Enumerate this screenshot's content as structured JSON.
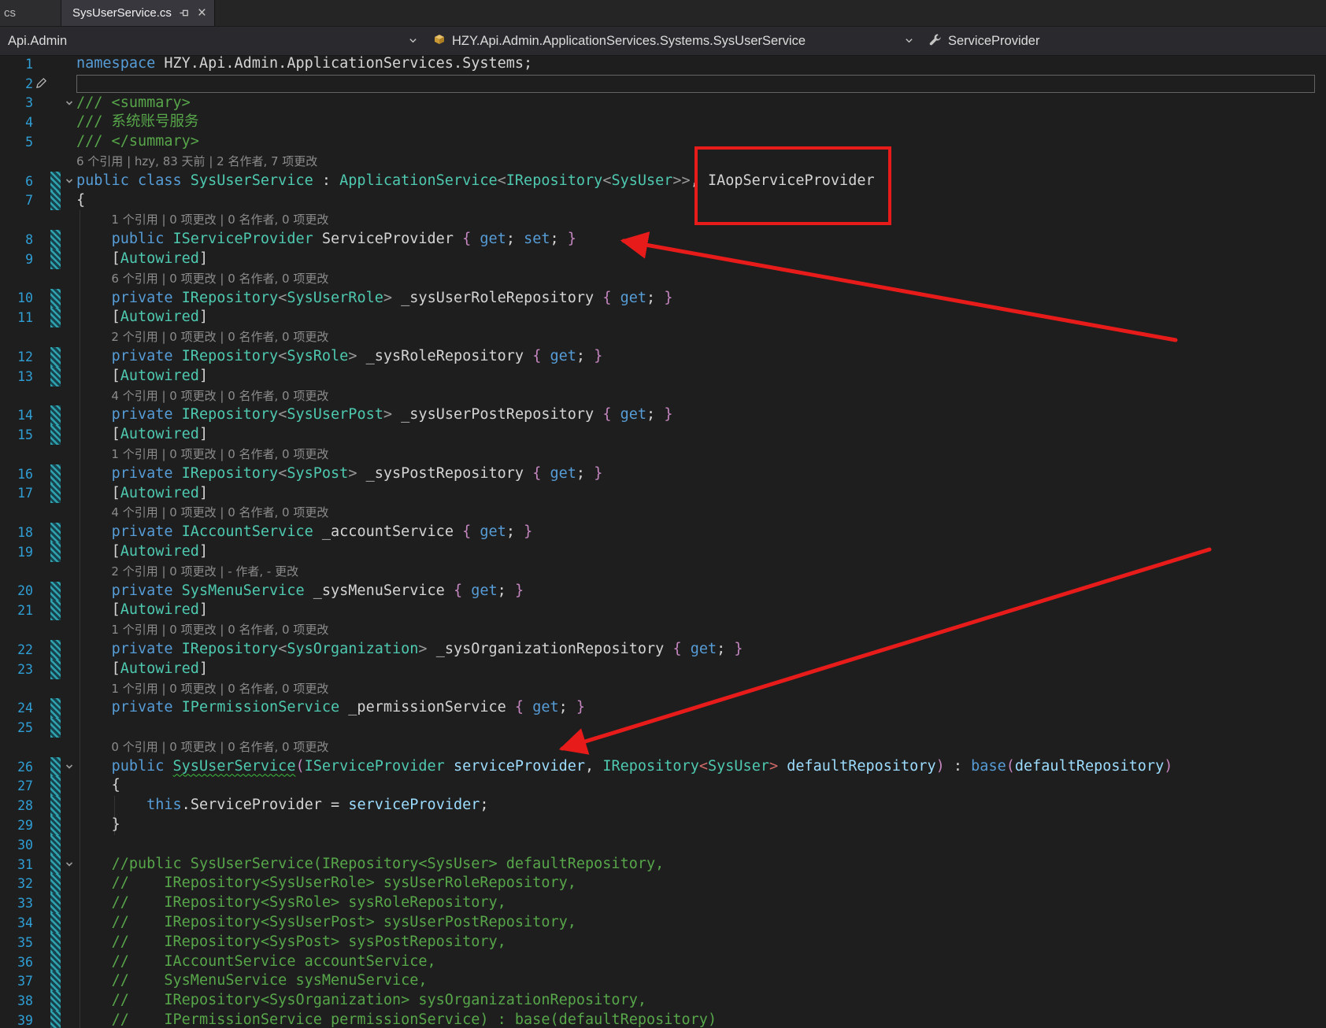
{
  "tabs": {
    "partial_label": "cs",
    "active_label": "SysUserService.cs"
  },
  "navbar": {
    "project": "Api.Admin",
    "type": "HZY.Api.Admin.ApplicationServices.Systems.SysUserService",
    "member": "ServiceProvider"
  },
  "icons": {
    "tab_pin": "pin-icon",
    "tab_close_glyph": "×",
    "type_glyph": "class-icon",
    "member_glyph": "wrench-icon",
    "fold_glyph": "chevron-down-icon",
    "gutter_edit": "pencil-icon",
    "dropdown_glyph": "chevron-down-icon"
  },
  "annotations": {
    "color": "#e81b1b",
    "boxed_text": "IAopServiceProvider",
    "arrows": 2
  },
  "colors": {
    "background": "#1e1e1e",
    "keyword": "#569cd6",
    "type": "#4ec9b0",
    "comment": "#57a64a",
    "parameter": "#9cdcfe",
    "brace": "#c586c0",
    "line_number": "#2f9fd6",
    "change_stripe": "#2fa3ad"
  },
  "editor": {
    "rows": [
      {
        "n": "1",
        "x": [
          [
            "namespace ",
            "kw"
          ],
          [
            "HZY.Api.Admin.ApplicationServices.Systems",
            "pl"
          ],
          [
            ";",
            "pl"
          ]
        ]
      },
      {
        "n": "2",
        "cur": true,
        "pencil": true,
        "x": []
      },
      {
        "n": "3",
        "fold": true,
        "x": [
          [
            "/// <summary>",
            "cm"
          ]
        ]
      },
      {
        "n": "4",
        "x": [
          [
            "/// 系统账号服务",
            "cm"
          ]
        ]
      },
      {
        "n": "5",
        "x": [
          [
            "/// </summary>",
            "cm"
          ]
        ]
      },
      {
        "t": "lens",
        "indent": 0,
        "text": "6 个引用 | hzy, 83 天前 | 2 名作者, 7 项更改"
      },
      {
        "n": "6",
        "fold": true,
        "stripe": true,
        "x": [
          [
            "public ",
            "kw"
          ],
          [
            "class ",
            "kw"
          ],
          [
            "SysUserService",
            "ty"
          ],
          [
            " : ",
            "pl"
          ],
          [
            "ApplicationService",
            "ty"
          ],
          [
            "<",
            "ang"
          ],
          [
            "IRepository",
            "ty"
          ],
          [
            "<",
            "ang"
          ],
          [
            "SysUser",
            "ty"
          ],
          [
            ">>",
            "ang"
          ],
          [
            ", ",
            "pl"
          ],
          [
            "IAopServiceProvider",
            "pl"
          ]
        ]
      },
      {
        "n": "7",
        "stripe": true,
        "x": [
          [
            "{",
            "pl"
          ]
        ]
      },
      {
        "t": "lens",
        "indent": 4,
        "text": "1 个引用 | 0 项更改 | 0 名作者, 0 项更改"
      },
      {
        "n": "8",
        "stripe": true,
        "x": [
          [
            "    ",
            "pl"
          ],
          [
            "public ",
            "kw"
          ],
          [
            "IServiceProvider",
            "ty"
          ],
          [
            " ServiceProvider ",
            "pl"
          ],
          [
            "{",
            "br"
          ],
          [
            " ",
            "pl"
          ],
          [
            "get",
            "kw"
          ],
          [
            "; ",
            "pl"
          ],
          [
            "set",
            "kw"
          ],
          [
            "; ",
            "pl"
          ],
          [
            "}",
            "br"
          ]
        ]
      },
      {
        "n": "9",
        "stripe": true,
        "x": [
          [
            "    ",
            "pl"
          ],
          [
            "[",
            "pl"
          ],
          [
            "Autowired",
            "ty"
          ],
          [
            "]",
            "pl"
          ]
        ]
      },
      {
        "t": "lens",
        "indent": 4,
        "text": "6 个引用 | 0 项更改 | 0 名作者, 0 项更改"
      },
      {
        "n": "10",
        "stripe": true,
        "x": [
          [
            "    ",
            "pl"
          ],
          [
            "private ",
            "kw"
          ],
          [
            "IRepository",
            "ty"
          ],
          [
            "<",
            "ang"
          ],
          [
            "SysUserRole",
            "ty"
          ],
          [
            ">",
            "ang"
          ],
          [
            " _sysUserRoleRepository ",
            "pl"
          ],
          [
            "{",
            "br"
          ],
          [
            " ",
            "pl"
          ],
          [
            "get",
            "kw"
          ],
          [
            "; ",
            "pl"
          ],
          [
            "}",
            "br"
          ]
        ]
      },
      {
        "n": "11",
        "stripe": true,
        "x": [
          [
            "    ",
            "pl"
          ],
          [
            "[",
            "pl"
          ],
          [
            "Autowired",
            "ty"
          ],
          [
            "]",
            "pl"
          ]
        ]
      },
      {
        "t": "lens",
        "indent": 4,
        "text": "2 个引用 | 0 项更改 | 0 名作者, 0 项更改"
      },
      {
        "n": "12",
        "stripe": true,
        "x": [
          [
            "    ",
            "pl"
          ],
          [
            "private ",
            "kw"
          ],
          [
            "IRepository",
            "ty"
          ],
          [
            "<",
            "ang"
          ],
          [
            "SysRole",
            "ty"
          ],
          [
            ">",
            "ang"
          ],
          [
            " _sysRoleRepository ",
            "pl"
          ],
          [
            "{",
            "br"
          ],
          [
            " ",
            "pl"
          ],
          [
            "get",
            "kw"
          ],
          [
            "; ",
            "pl"
          ],
          [
            "}",
            "br"
          ]
        ]
      },
      {
        "n": "13",
        "stripe": true,
        "x": [
          [
            "    ",
            "pl"
          ],
          [
            "[",
            "pl"
          ],
          [
            "Autowired",
            "ty"
          ],
          [
            "]",
            "pl"
          ]
        ]
      },
      {
        "t": "lens",
        "indent": 4,
        "text": "4 个引用 | 0 项更改 | 0 名作者, 0 项更改"
      },
      {
        "n": "14",
        "stripe": true,
        "x": [
          [
            "    ",
            "pl"
          ],
          [
            "private ",
            "kw"
          ],
          [
            "IRepository",
            "ty"
          ],
          [
            "<",
            "ang"
          ],
          [
            "SysUserPost",
            "ty"
          ],
          [
            ">",
            "ang"
          ],
          [
            " _sysUserPostRepository ",
            "pl"
          ],
          [
            "{",
            "br"
          ],
          [
            " ",
            "pl"
          ],
          [
            "get",
            "kw"
          ],
          [
            "; ",
            "pl"
          ],
          [
            "}",
            "br"
          ]
        ]
      },
      {
        "n": "15",
        "stripe": true,
        "x": [
          [
            "    ",
            "pl"
          ],
          [
            "[",
            "pl"
          ],
          [
            "Autowired",
            "ty"
          ],
          [
            "]",
            "pl"
          ]
        ]
      },
      {
        "t": "lens",
        "indent": 4,
        "text": "1 个引用 | 0 项更改 | 0 名作者, 0 项更改"
      },
      {
        "n": "16",
        "stripe": true,
        "x": [
          [
            "    ",
            "pl"
          ],
          [
            "private ",
            "kw"
          ],
          [
            "IRepository",
            "ty"
          ],
          [
            "<",
            "ang"
          ],
          [
            "SysPost",
            "ty"
          ],
          [
            ">",
            "ang"
          ],
          [
            " _sysPostRepository ",
            "pl"
          ],
          [
            "{",
            "br"
          ],
          [
            " ",
            "pl"
          ],
          [
            "get",
            "kw"
          ],
          [
            "; ",
            "pl"
          ],
          [
            "}",
            "br"
          ]
        ]
      },
      {
        "n": "17",
        "stripe": true,
        "x": [
          [
            "    ",
            "pl"
          ],
          [
            "[",
            "pl"
          ],
          [
            "Autowired",
            "ty"
          ],
          [
            "]",
            "pl"
          ]
        ]
      },
      {
        "t": "lens",
        "indent": 4,
        "text": "4 个引用 | 0 项更改 | 0 名作者, 0 项更改"
      },
      {
        "n": "18",
        "stripe": true,
        "x": [
          [
            "    ",
            "pl"
          ],
          [
            "private ",
            "kw"
          ],
          [
            "IAccountService",
            "ty"
          ],
          [
            " _accountService ",
            "pl"
          ],
          [
            "{",
            "br"
          ],
          [
            " ",
            "pl"
          ],
          [
            "get",
            "kw"
          ],
          [
            "; ",
            "pl"
          ],
          [
            "}",
            "br"
          ]
        ]
      },
      {
        "n": "19",
        "stripe": true,
        "x": [
          [
            "    ",
            "pl"
          ],
          [
            "[",
            "pl"
          ],
          [
            "Autowired",
            "ty"
          ],
          [
            "]",
            "pl"
          ]
        ]
      },
      {
        "t": "lens",
        "indent": 4,
        "text": "2 个引用 | 0 项更改 | - 作者, - 更改"
      },
      {
        "n": "20",
        "stripe": true,
        "x": [
          [
            "    ",
            "pl"
          ],
          [
            "private ",
            "kw"
          ],
          [
            "SysMenuService",
            "ty"
          ],
          [
            " _sysMenuService ",
            "pl"
          ],
          [
            "{",
            "br"
          ],
          [
            " ",
            "pl"
          ],
          [
            "get",
            "kw"
          ],
          [
            "; ",
            "pl"
          ],
          [
            "}",
            "br"
          ]
        ]
      },
      {
        "n": "21",
        "stripe": true,
        "x": [
          [
            "    ",
            "pl"
          ],
          [
            "[",
            "pl"
          ],
          [
            "Autowired",
            "ty"
          ],
          [
            "]",
            "pl"
          ]
        ]
      },
      {
        "t": "lens",
        "indent": 4,
        "text": "1 个引用 | 0 项更改 | 0 名作者, 0 项更改"
      },
      {
        "n": "22",
        "stripe": true,
        "x": [
          [
            "    ",
            "pl"
          ],
          [
            "private ",
            "kw"
          ],
          [
            "IRepository",
            "ty"
          ],
          [
            "<",
            "ang"
          ],
          [
            "SysOrganization",
            "ty"
          ],
          [
            ">",
            "ang"
          ],
          [
            " _sysOrganizationRepository ",
            "pl"
          ],
          [
            "{",
            "br"
          ],
          [
            " ",
            "pl"
          ],
          [
            "get",
            "kw"
          ],
          [
            "; ",
            "pl"
          ],
          [
            "}",
            "br"
          ]
        ]
      },
      {
        "n": "23",
        "stripe": true,
        "x": [
          [
            "    ",
            "pl"
          ],
          [
            "[",
            "pl"
          ],
          [
            "Autowired",
            "ty"
          ],
          [
            "]",
            "pl"
          ]
        ]
      },
      {
        "t": "lens",
        "indent": 4,
        "text": "1 个引用 | 0 项更改 | 0 名作者, 0 项更改"
      },
      {
        "n": "24",
        "stripe": true,
        "x": [
          [
            "    ",
            "pl"
          ],
          [
            "private ",
            "kw"
          ],
          [
            "IPermissionService",
            "ty"
          ],
          [
            " _permissionService ",
            "pl"
          ],
          [
            "{",
            "br"
          ],
          [
            " ",
            "pl"
          ],
          [
            "get",
            "kw"
          ],
          [
            "; ",
            "pl"
          ],
          [
            "}",
            "br"
          ]
        ]
      },
      {
        "n": "25",
        "stripe": true,
        "x": []
      },
      {
        "t": "lens",
        "indent": 4,
        "text": "0 个引用 | 0 项更改 | 0 名作者, 0 项更改"
      },
      {
        "n": "26",
        "fold": true,
        "stripe": true,
        "x": [
          [
            "    ",
            "pl"
          ],
          [
            "public ",
            "kw"
          ],
          [
            "SysUserService",
            "ty sq"
          ],
          [
            "(",
            "br"
          ],
          [
            "IServiceProvider",
            "ty"
          ],
          [
            " ",
            "pl"
          ],
          [
            "serviceProvider",
            "pm"
          ],
          [
            ", ",
            "pl"
          ],
          [
            "IRepository",
            "ty"
          ],
          [
            "<",
            "red"
          ],
          [
            "SysUser",
            "ty"
          ],
          [
            ">",
            "red"
          ],
          [
            " ",
            "pl"
          ],
          [
            "defaultRepository",
            "pm"
          ],
          [
            ")",
            "br"
          ],
          [
            " : ",
            "pl"
          ],
          [
            "base",
            "kw"
          ],
          [
            "(",
            "br"
          ],
          [
            "defaultRepository",
            "pm"
          ],
          [
            ")",
            "br"
          ]
        ]
      },
      {
        "n": "27",
        "stripe": true,
        "x": [
          [
            "    ",
            "pl"
          ],
          [
            "{",
            "pl"
          ]
        ]
      },
      {
        "n": "28",
        "stripe": true,
        "x": [
          [
            "        ",
            "pl"
          ],
          [
            "this",
            "kw"
          ],
          [
            ".",
            "pl"
          ],
          [
            "ServiceProvider",
            "pl"
          ],
          [
            " = ",
            "pl"
          ],
          [
            "serviceProvider",
            "pm"
          ],
          [
            ";",
            "pl"
          ]
        ]
      },
      {
        "n": "29",
        "stripe": true,
        "x": [
          [
            "    ",
            "pl"
          ],
          [
            "}",
            "pl"
          ]
        ]
      },
      {
        "n": "30",
        "stripe": true,
        "x": []
      },
      {
        "n": "31",
        "fold": true,
        "stripe": true,
        "x": [
          [
            "    ",
            "pl"
          ],
          [
            "//public SysUserService(IRepository<SysUser> defaultRepository,",
            "cm"
          ]
        ]
      },
      {
        "n": "32",
        "stripe": true,
        "x": [
          [
            "    ",
            "pl"
          ],
          [
            "//    IRepository<SysUserRole> sysUserRoleRepository,",
            "cm"
          ]
        ]
      },
      {
        "n": "33",
        "stripe": true,
        "x": [
          [
            "    ",
            "pl"
          ],
          [
            "//    IRepository<SysRole> sysRoleRepository,",
            "cm"
          ]
        ]
      },
      {
        "n": "34",
        "stripe": true,
        "x": [
          [
            "    ",
            "pl"
          ],
          [
            "//    IRepository<SysUserPost> sysUserPostRepository,",
            "cm"
          ]
        ]
      },
      {
        "n": "35",
        "stripe": true,
        "x": [
          [
            "    ",
            "pl"
          ],
          [
            "//    IRepository<SysPost> sysPostRepository,",
            "cm"
          ]
        ]
      },
      {
        "n": "36",
        "stripe": true,
        "x": [
          [
            "    ",
            "pl"
          ],
          [
            "//    IAccountService accountService,",
            "cm"
          ]
        ]
      },
      {
        "n": "37",
        "stripe": true,
        "x": [
          [
            "    ",
            "pl"
          ],
          [
            "//    SysMenuService sysMenuService,",
            "cm"
          ]
        ]
      },
      {
        "n": "38",
        "stripe": true,
        "x": [
          [
            "    ",
            "pl"
          ],
          [
            "//    IRepository<SysOrganization> sysOrganizationRepository,",
            "cm"
          ]
        ]
      },
      {
        "n": "39",
        "stripe": true,
        "x": [
          [
            "    ",
            "pl"
          ],
          [
            "//    IPermissionService permissionService) : base(defaultRepository)",
            "cm"
          ]
        ]
      }
    ]
  }
}
